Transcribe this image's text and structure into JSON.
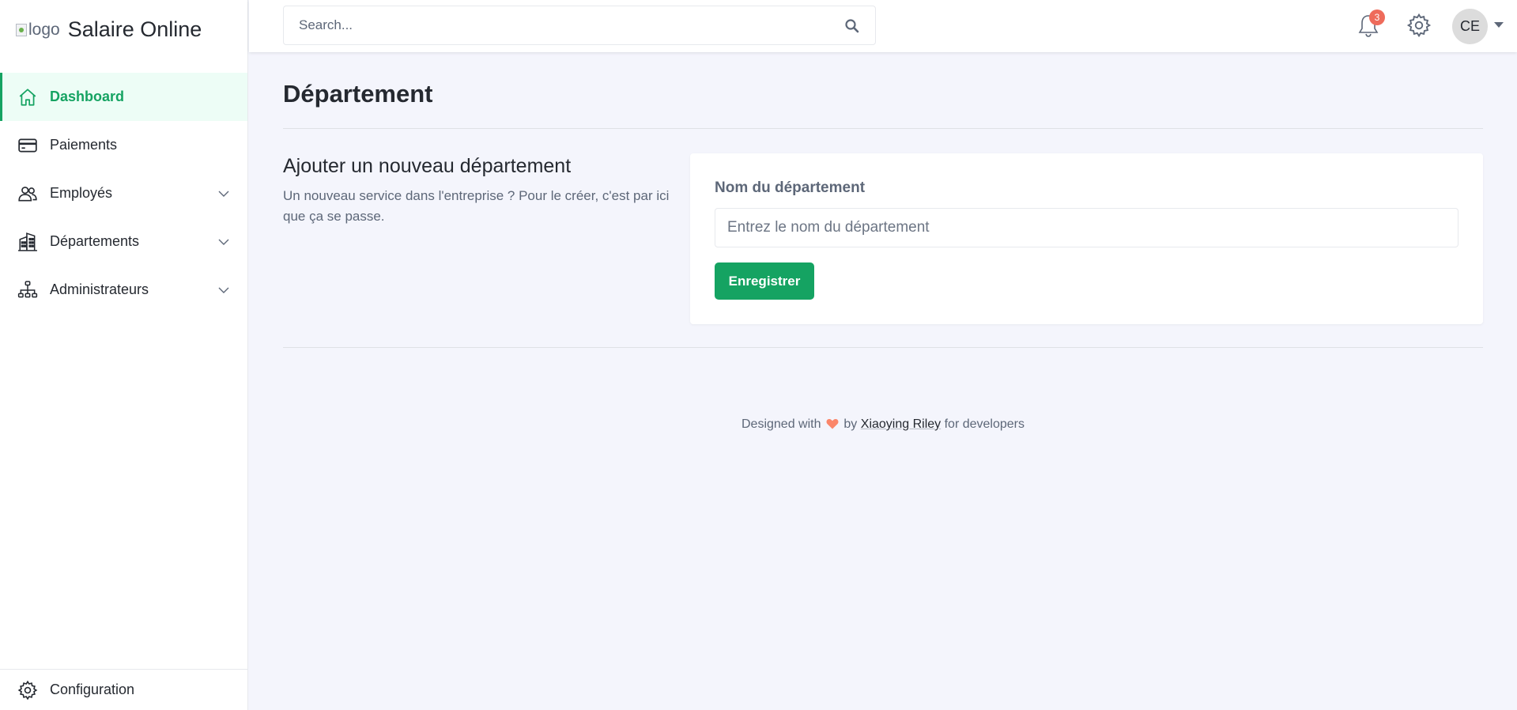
{
  "brand": {
    "logo_alt": "logo",
    "name": "Salaire Online"
  },
  "sidebar": {
    "items": [
      {
        "label": "Dashboard",
        "icon": "home-icon",
        "active": true
      },
      {
        "label": "Paiements",
        "icon": "card-icon"
      },
      {
        "label": "Employés",
        "icon": "users-icon",
        "has_submenu": true
      },
      {
        "label": "Départements",
        "icon": "building-icon",
        "has_submenu": true
      },
      {
        "label": "Administrateurs",
        "icon": "hierarchy-icon",
        "has_submenu": true
      }
    ],
    "footer_label": "Configuration"
  },
  "header": {
    "search_placeholder": "Search...",
    "notification_count": "3",
    "avatar_initials": "CE"
  },
  "page": {
    "title": "Département",
    "section_title": "Ajouter un nouveau département",
    "section_description": "Un nouveau service dans l'entreprise ? Pour le créer, c'est par ici que ça se passe.",
    "form": {
      "label": "Nom du département",
      "placeholder": "Entrez le nom du département",
      "value": "",
      "submit_label": "Enregistrer"
    }
  },
  "footer": {
    "prefix": "Designed with",
    "by": "by",
    "author": "Xiaoying Riley",
    "suffix": "for developers"
  },
  "colors": {
    "accent": "#15a362",
    "badge": "#ee6b5b",
    "heart": "#fb866a"
  }
}
